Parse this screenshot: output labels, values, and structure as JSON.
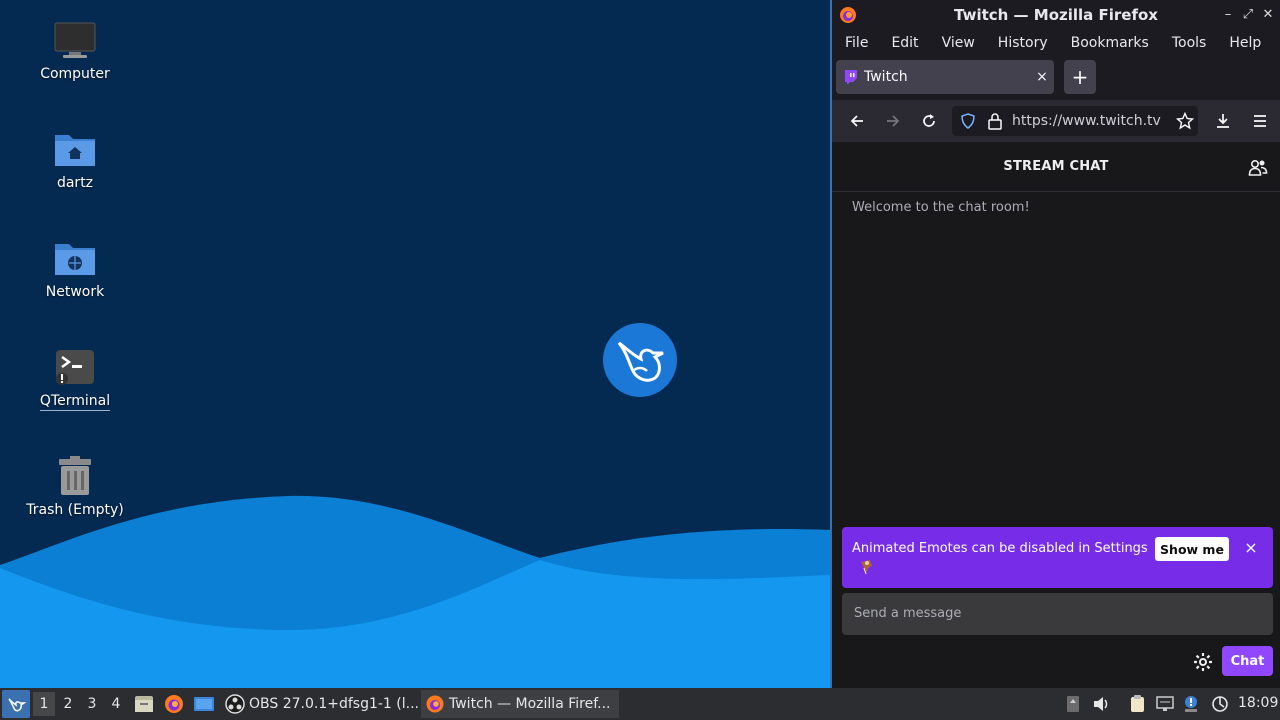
{
  "desktop": {
    "icons": [
      {
        "label": "Computer"
      },
      {
        "label": "dartz"
      },
      {
        "label": "Network"
      },
      {
        "label": "QTerminal"
      },
      {
        "label": "Trash (Empty)"
      }
    ]
  },
  "firefox": {
    "window_title": "Twitch — Mozilla Firefox",
    "menu": [
      "File",
      "Edit",
      "View",
      "History",
      "Bookmarks",
      "Tools",
      "Help"
    ],
    "tab": {
      "title": "Twitch",
      "close": "×"
    },
    "new_tab": "+",
    "url": "https://www.twitch.tv"
  },
  "chat": {
    "header": "STREAM CHAT",
    "welcome": "Welcome to the chat room!",
    "promo": {
      "text": "Animated Emotes can be disabled in Settings",
      "button": "Show me",
      "close": "×"
    },
    "input_placeholder": "Send a message",
    "send_button": "Chat"
  },
  "taskbar": {
    "workspaces": [
      "1",
      "2",
      "3",
      "4"
    ],
    "active_workspace": "1",
    "tasks": [
      {
        "label": "OBS 27.0.1+dfsg1-1 (l..."
      },
      {
        "label": "Twitch — Mozilla Firef..."
      }
    ],
    "clock": "18:09"
  },
  "colors": {
    "desktop_bg": "#052a52",
    "wave": "#0a8fe6",
    "twitch_purple": "#9147ff",
    "promo_purple": "#772ce8"
  }
}
